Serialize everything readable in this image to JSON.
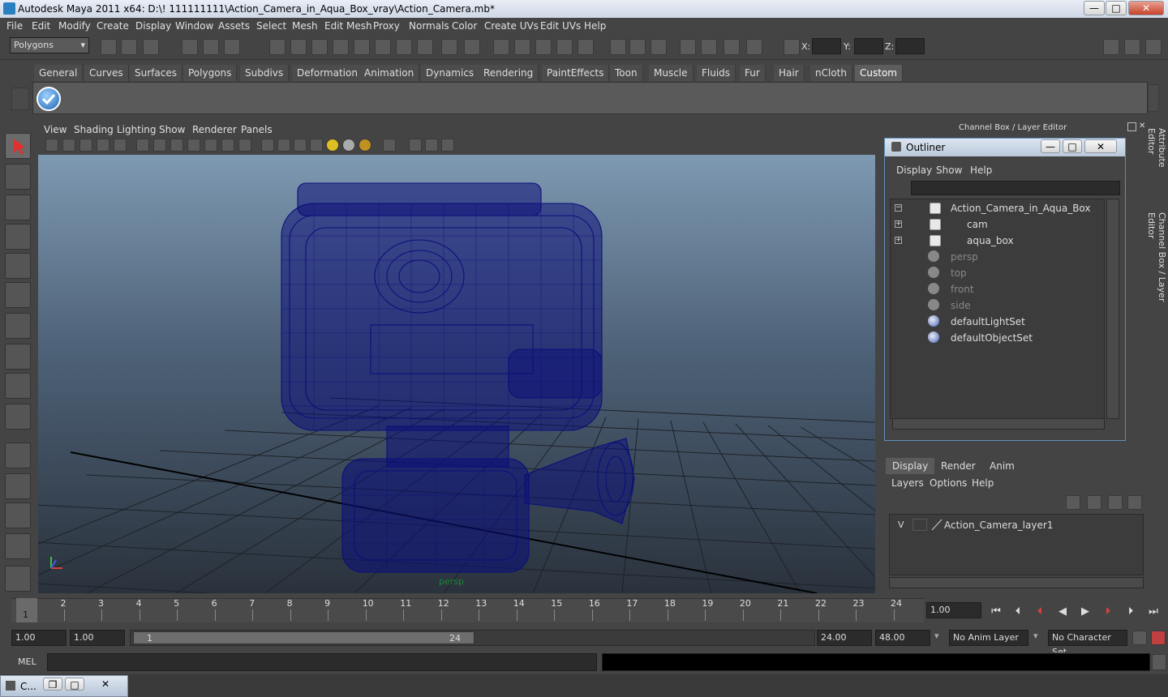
{
  "window": {
    "title": "Autodesk Maya 2011 x64: D:\\! 111111111\\Action_Camera_in_Aqua_Box_vray\\Action_Camera.mb*",
    "minimize": "—",
    "maximize": "□",
    "close": "✕"
  },
  "menubar": [
    "File",
    "Edit",
    "Modify",
    "Create",
    "Display",
    "Window",
    "Assets",
    "Select",
    "Mesh",
    "Edit Mesh",
    "Proxy",
    "Normals",
    "Color",
    "Create UVs",
    "Edit UVs",
    "Help"
  ],
  "status": {
    "mode": "Polygons",
    "x_label": "X:",
    "y_label": "Y:",
    "z_label": "Z:"
  },
  "shelf": {
    "tabs": [
      "General",
      "Curves",
      "Surfaces",
      "Polygons",
      "Subdivs",
      "Deformation",
      "Animation",
      "Dynamics",
      "Rendering",
      "PaintEffects",
      "Toon",
      "Muscle",
      "Fluids",
      "Fur",
      "Hair",
      "nCloth",
      "Custom"
    ],
    "active_tab": "Custom"
  },
  "viewport": {
    "menu": [
      "View",
      "Shading",
      "Lighting",
      "Show",
      "Renderer",
      "Panels"
    ],
    "camera_label": "persp",
    "wire_color": "#0b0f7a",
    "background_top": "#7e99b2",
    "background_bottom": "#2a323c"
  },
  "channel_box": {
    "header": "Channel Box / Layer Editor"
  },
  "outliner": {
    "title": "Outliner",
    "menu": [
      "Display",
      "Show",
      "Help"
    ],
    "items": [
      {
        "label": "Action_Camera_in_Aqua_Box",
        "type": "mesh",
        "expander": "−"
      },
      {
        "label": "cam",
        "type": "mesh",
        "expander": "+"
      },
      {
        "label": "aqua_box",
        "type": "mesh",
        "expander": "+"
      },
      {
        "label": "persp",
        "type": "camera"
      },
      {
        "label": "top",
        "type": "camera"
      },
      {
        "label": "front",
        "type": "camera"
      },
      {
        "label": "side",
        "type": "camera"
      },
      {
        "label": "defaultLightSet",
        "type": "set"
      },
      {
        "label": "defaultObjectSet",
        "type": "set"
      }
    ]
  },
  "layer_editor": {
    "tabs": [
      "Display",
      "Render",
      "Anim"
    ],
    "active_tab": "Display",
    "menu": [
      "Layers",
      "Options",
      "Help"
    ],
    "layers": [
      {
        "visible": "V",
        "name": "Action_Camera_layer1"
      }
    ]
  },
  "side_tabs": [
    "Attribute Editor",
    "Channel Box / Layer Editor"
  ],
  "timeline": {
    "ticks": [
      "1",
      "2",
      "3",
      "4",
      "5",
      "6",
      "7",
      "8",
      "9",
      "10",
      "11",
      "12",
      "13",
      "14",
      "15",
      "16",
      "17",
      "18",
      "19",
      "20",
      "21",
      "22",
      "23",
      "24"
    ],
    "current_frame_marker": "1",
    "current_time": "1.00"
  },
  "range": {
    "start": "1.00",
    "playback_start": "1.00",
    "slider_start": "1",
    "slider_end": "24",
    "playback_end": "24.00",
    "end": "48.00",
    "anim_layer": "No Anim Layer",
    "character_set": "No Character Set"
  },
  "command": {
    "label": "MEL"
  },
  "taskbar": {
    "label": "C..."
  }
}
